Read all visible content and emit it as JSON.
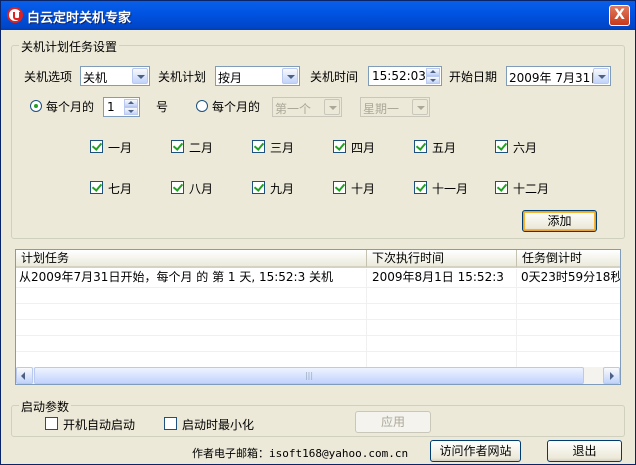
{
  "window": {
    "title": "白云定时关机专家",
    "close_label": "X"
  },
  "plan_group": {
    "label": "关机计划任务设置",
    "shutdown_option_label": "关机选项",
    "shutdown_option_value": "关机",
    "plan_label": "关机计划",
    "plan_value": "按月",
    "time_label": "关机时间",
    "time_value": "15:52:03",
    "start_date_label": "开始日期",
    "start_date_value": "2009年 7月31日",
    "radio1_label": "每个月的",
    "day_value": "1",
    "day_unit": "号",
    "radio2_label": "每个月的",
    "week_index_value": "第一个",
    "weekday_value": "星期一",
    "months": [
      "一月",
      "二月",
      "三月",
      "四月",
      "五月",
      "六月",
      "七月",
      "八月",
      "九月",
      "十月",
      "十一月",
      "十二月"
    ],
    "add_button": "添加"
  },
  "task_list": {
    "columns": [
      "计划任务",
      "下次执行时间",
      "任务倒计时"
    ],
    "rows": [
      {
        "task": "从2009年7月31日开始，每个月 的 第 1 天, 15:52:3 关机",
        "next_run": "2009年8月1日 15:52:3",
        "countdown": "0天23时59分18秒"
      }
    ],
    "scroll_grip": "|||"
  },
  "startup_group": {
    "label": "启动参数",
    "autostart_label": "开机自动启动",
    "minimize_label": "启动时最小化",
    "apply_button": "应用"
  },
  "footer": {
    "email_text": "作者电子邮箱：isoft168@yahoo.com.cn",
    "visit_button": "访问作者网站",
    "exit_button": "退出"
  },
  "colors": {
    "titlebar": "#0054e3",
    "window_bg": "#ece9d8",
    "checkbox_mark": "#21a121"
  }
}
